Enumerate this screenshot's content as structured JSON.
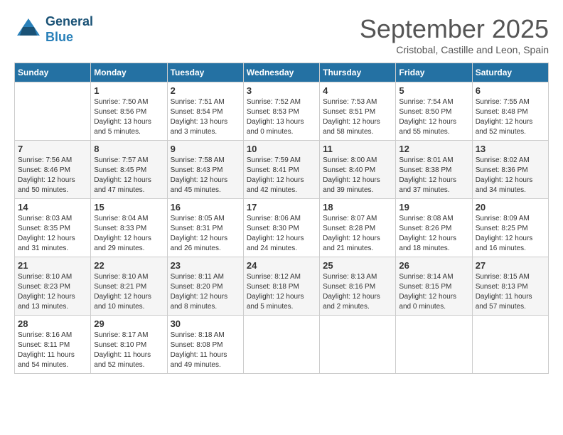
{
  "logo": {
    "general": "General",
    "blue": "Blue"
  },
  "title": "September 2025",
  "subtitle": "Cristobal, Castille and Leon, Spain",
  "days_header": [
    "Sunday",
    "Monday",
    "Tuesday",
    "Wednesday",
    "Thursday",
    "Friday",
    "Saturday"
  ],
  "weeks": [
    [
      {
        "day": "",
        "info": ""
      },
      {
        "day": "1",
        "info": "Sunrise: 7:50 AM\nSunset: 8:56 PM\nDaylight: 13 hours\nand 5 minutes."
      },
      {
        "day": "2",
        "info": "Sunrise: 7:51 AM\nSunset: 8:54 PM\nDaylight: 13 hours\nand 3 minutes."
      },
      {
        "day": "3",
        "info": "Sunrise: 7:52 AM\nSunset: 8:53 PM\nDaylight: 13 hours\nand 0 minutes."
      },
      {
        "day": "4",
        "info": "Sunrise: 7:53 AM\nSunset: 8:51 PM\nDaylight: 12 hours\nand 58 minutes."
      },
      {
        "day": "5",
        "info": "Sunrise: 7:54 AM\nSunset: 8:50 PM\nDaylight: 12 hours\nand 55 minutes."
      },
      {
        "day": "6",
        "info": "Sunrise: 7:55 AM\nSunset: 8:48 PM\nDaylight: 12 hours\nand 52 minutes."
      }
    ],
    [
      {
        "day": "7",
        "info": "Sunrise: 7:56 AM\nSunset: 8:46 PM\nDaylight: 12 hours\nand 50 minutes."
      },
      {
        "day": "8",
        "info": "Sunrise: 7:57 AM\nSunset: 8:45 PM\nDaylight: 12 hours\nand 47 minutes."
      },
      {
        "day": "9",
        "info": "Sunrise: 7:58 AM\nSunset: 8:43 PM\nDaylight: 12 hours\nand 45 minutes."
      },
      {
        "day": "10",
        "info": "Sunrise: 7:59 AM\nSunset: 8:41 PM\nDaylight: 12 hours\nand 42 minutes."
      },
      {
        "day": "11",
        "info": "Sunrise: 8:00 AM\nSunset: 8:40 PM\nDaylight: 12 hours\nand 39 minutes."
      },
      {
        "day": "12",
        "info": "Sunrise: 8:01 AM\nSunset: 8:38 PM\nDaylight: 12 hours\nand 37 minutes."
      },
      {
        "day": "13",
        "info": "Sunrise: 8:02 AM\nSunset: 8:36 PM\nDaylight: 12 hours\nand 34 minutes."
      }
    ],
    [
      {
        "day": "14",
        "info": "Sunrise: 8:03 AM\nSunset: 8:35 PM\nDaylight: 12 hours\nand 31 minutes."
      },
      {
        "day": "15",
        "info": "Sunrise: 8:04 AM\nSunset: 8:33 PM\nDaylight: 12 hours\nand 29 minutes."
      },
      {
        "day": "16",
        "info": "Sunrise: 8:05 AM\nSunset: 8:31 PM\nDaylight: 12 hours\nand 26 minutes."
      },
      {
        "day": "17",
        "info": "Sunrise: 8:06 AM\nSunset: 8:30 PM\nDaylight: 12 hours\nand 24 minutes."
      },
      {
        "day": "18",
        "info": "Sunrise: 8:07 AM\nSunset: 8:28 PM\nDaylight: 12 hours\nand 21 minutes."
      },
      {
        "day": "19",
        "info": "Sunrise: 8:08 AM\nSunset: 8:26 PM\nDaylight: 12 hours\nand 18 minutes."
      },
      {
        "day": "20",
        "info": "Sunrise: 8:09 AM\nSunset: 8:25 PM\nDaylight: 12 hours\nand 16 minutes."
      }
    ],
    [
      {
        "day": "21",
        "info": "Sunrise: 8:10 AM\nSunset: 8:23 PM\nDaylight: 12 hours\nand 13 minutes."
      },
      {
        "day": "22",
        "info": "Sunrise: 8:10 AM\nSunset: 8:21 PM\nDaylight: 12 hours\nand 10 minutes."
      },
      {
        "day": "23",
        "info": "Sunrise: 8:11 AM\nSunset: 8:20 PM\nDaylight: 12 hours\nand 8 minutes."
      },
      {
        "day": "24",
        "info": "Sunrise: 8:12 AM\nSunset: 8:18 PM\nDaylight: 12 hours\nand 5 minutes."
      },
      {
        "day": "25",
        "info": "Sunrise: 8:13 AM\nSunset: 8:16 PM\nDaylight: 12 hours\nand 2 minutes."
      },
      {
        "day": "26",
        "info": "Sunrise: 8:14 AM\nSunset: 8:15 PM\nDaylight: 12 hours\nand 0 minutes."
      },
      {
        "day": "27",
        "info": "Sunrise: 8:15 AM\nSunset: 8:13 PM\nDaylight: 11 hours\nand 57 minutes."
      }
    ],
    [
      {
        "day": "28",
        "info": "Sunrise: 8:16 AM\nSunset: 8:11 PM\nDaylight: 11 hours\nand 54 minutes."
      },
      {
        "day": "29",
        "info": "Sunrise: 8:17 AM\nSunset: 8:10 PM\nDaylight: 11 hours\nand 52 minutes."
      },
      {
        "day": "30",
        "info": "Sunrise: 8:18 AM\nSunset: 8:08 PM\nDaylight: 11 hours\nand 49 minutes."
      },
      {
        "day": "",
        "info": ""
      },
      {
        "day": "",
        "info": ""
      },
      {
        "day": "",
        "info": ""
      },
      {
        "day": "",
        "info": ""
      }
    ]
  ]
}
